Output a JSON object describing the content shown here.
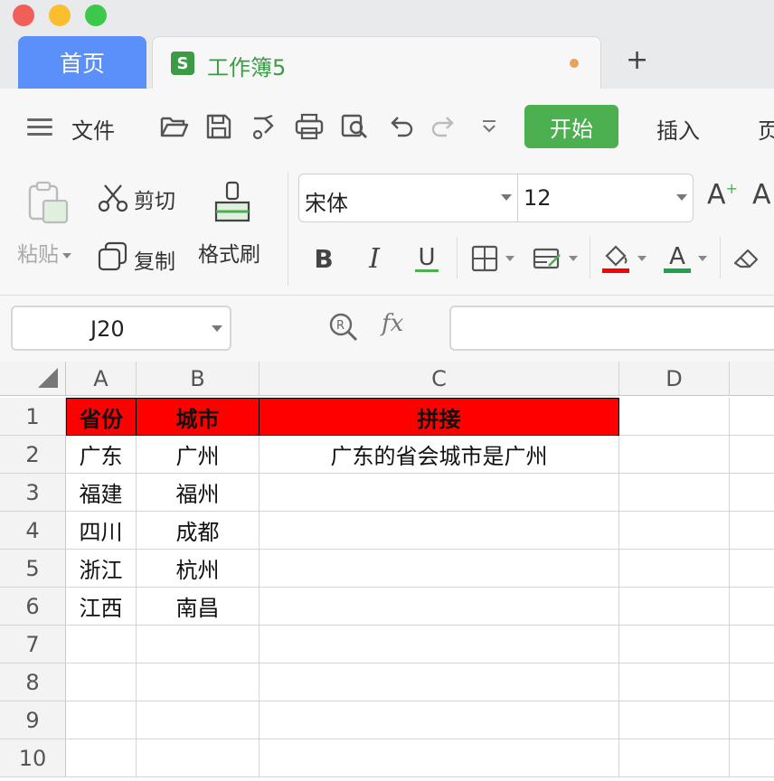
{
  "window": {
    "tabs": {
      "home": "首页",
      "document": "工作簿5",
      "document_icon_letter": "S",
      "add": "+"
    }
  },
  "toolbar": {
    "file_menu": "文件",
    "quick_access": [
      "open-icon",
      "save-icon",
      "export-icon",
      "print-icon",
      "print-preview-icon",
      "undo-icon",
      "redo-icon",
      "more-icon"
    ],
    "ribbon_tabs": {
      "start": "开始",
      "insert": "插入",
      "page": "页"
    },
    "clipboard": {
      "paste": "粘贴",
      "cut": "剪切",
      "copy": "复制",
      "format_painter": "格式刷"
    },
    "font": {
      "name": "宋体",
      "size": "12",
      "grow": "A",
      "grow_sign": "+",
      "shrink": "A"
    },
    "format_buttons": {
      "bold": "B",
      "italic": "I",
      "underline": "U",
      "font_color": "A"
    },
    "colors": {
      "accent_green": "#4caf50",
      "fill_color": "#ff0000",
      "font_color": "#1aa34a"
    }
  },
  "formula_bar": {
    "cell_ref": "J20",
    "fx": "fx",
    "value": ""
  },
  "sheet": {
    "columns": [
      "A",
      "B",
      "C",
      "D"
    ],
    "rows": [
      "1",
      "2",
      "3",
      "4",
      "5",
      "6",
      "7",
      "8",
      "9",
      "10"
    ],
    "header_fill": "#ff0000",
    "cells": [
      [
        "省份",
        "城市",
        "拼接"
      ],
      [
        "广东",
        "广州",
        "广东的省会城市是广州"
      ],
      [
        "福建",
        "福州",
        ""
      ],
      [
        "四川",
        "成都",
        ""
      ],
      [
        "浙江",
        "杭州",
        ""
      ],
      [
        "江西",
        "南昌",
        ""
      ]
    ]
  }
}
